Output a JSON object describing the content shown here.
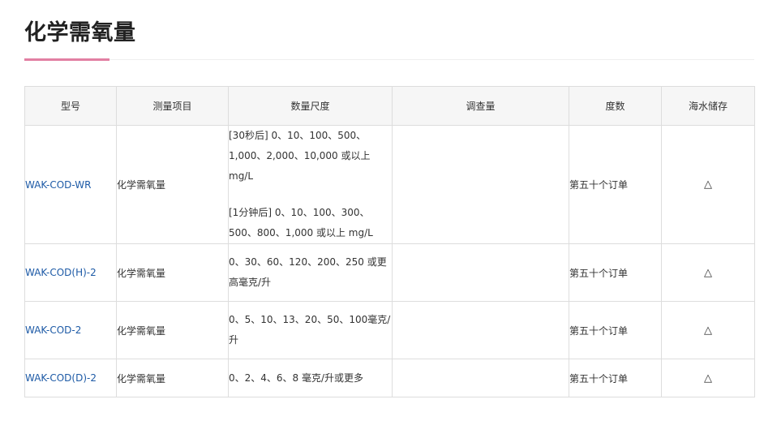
{
  "page": {
    "title": "化学需氧量"
  },
  "table": {
    "headers": {
      "model": "型号",
      "item": "测量项目",
      "range": "数量尺度",
      "survey": "调查量",
      "order": "度数",
      "marine": "海水储存"
    },
    "rows": [
      {
        "model": "WAK-COD-WR",
        "item": "化学需氧量",
        "range": [
          "[30秒后] 0、10、100、500、1,000、2,000、10,000 或以上 mg/L",
          "[1分钟后] 0、10、100、300、500、800、1,000 或以上 mg/L"
        ],
        "survey": "",
        "order": "第五十个订单",
        "marine": "△"
      },
      {
        "model": "WAK-COD(H)-2",
        "item": "化学需氧量",
        "range": [
          "0、30、60、120、200、250 或更高毫克/升"
        ],
        "survey": "",
        "order": "第五十个订单",
        "marine": "△"
      },
      {
        "model": "WAK-COD-2",
        "item": "化学需氧量",
        "range": [
          "0、5、10、13、20、50、100毫克/升"
        ],
        "survey": "",
        "order": "第五十个订单",
        "marine": "△"
      },
      {
        "model": "WAK-COD(D)-2",
        "item": "化学需氧量",
        "range": [
          "0、2、4、6、8 毫克/升或更多"
        ],
        "survey": "",
        "order": "第五十个订单",
        "marine": "△"
      }
    ]
  },
  "colors": {
    "accent": "#e27fa3",
    "model_link": "#1d5aa6",
    "header_bg": "#f6f6f6",
    "border": "#dddddd"
  }
}
